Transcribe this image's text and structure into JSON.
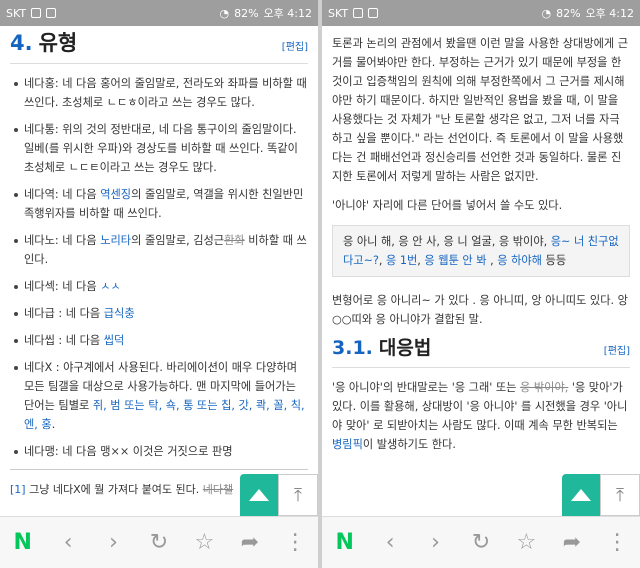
{
  "status": {
    "carrier": "SKT",
    "battery": "82%",
    "time": "오후 4:12"
  },
  "left": {
    "heading": {
      "number": "4.",
      "title": "유형",
      "edit": "[편집]"
    },
    "items": [
      {
        "text": "네다홍: 네 다음 홍어의 줄임말로, 전라도와 좌파를 비하할 때 쓰인다. 초성체로 ㄴㄷㅎ이라고 쓰는 경우도 많다."
      },
      {
        "text": "네다통: 위의 것의 정반대로, 네 다음 통구이의 줄임말이다. 일베(를 위시한 우파)와 경상도를 비하할 때 쓰인다. 똑같이 초성체로 ㄴㄷㅌ이라고 쓰는 경우도 많다."
      },
      {
        "pre": "네다역: 네 다음 ",
        "link": "역센징",
        "post": "의 줄임말로, 역갤을 위시한 친일반민족행위자를 비하할 때 쓰인다."
      },
      {
        "pre": "네다노: 네 다음 ",
        "link": "노리타",
        "mid": "의 줄임말로, 김성근",
        "strike": "환화",
        "post": " 비하할 때 쓰인다."
      },
      {
        "pre": "네다섹: 네 다음 ",
        "link": "ㅅㅅ",
        "post": ""
      },
      {
        "pre": "네다급 : 네 다음 ",
        "link": "급식충",
        "post": ""
      },
      {
        "pre": "네다씹 : 네 다음 ",
        "link": "씹덕",
        "post": ""
      },
      {
        "pre": "네다X : 야구계에서 사용된다. 바리에이션이 매우 다양하며 모든 팀갤을 대상으로 사용가능하다. 맨 마지막에 들어가는 단어는 팀별로 ",
        "link": "쥐, 범 또는 탁, 쇽, 통 또는 칩, 갓, 콱, 꼴, 칙, 엔, 홍",
        "post": "."
      },
      {
        "text": "네다맹: 네 다음 맹×× 이것은 거짓으로 판명"
      }
    ],
    "footnote": {
      "ref": "[1]",
      "text": " 그냥 네다X에 뭘 가져다 붙여도 된다. ",
      "strike": "네다챌"
    }
  },
  "right": {
    "para1": "토론과 논리의 관점에서 봤을땐 이런 말을 사용한 상대방에게 근거를 물어봐야만 한다. 부정하는 근거가 있기 때문에 부정을 한것이고 입증책임의 원칙에 의해 부정한쪽에서 그 근거를 제시해야만 하기 때문이다. 하지만 일반적인 용법을 봤을 때, 이 말을 사용했다는 것 자체가 \"난 토론할 생각은 없고, 그저 너를 자극하고 싶을 뿐이다.\" 라는 선언이다. 즉 토론에서 이 말을 사용했다는 건 패배선언과 정신승리를 선언한 것과 동일하다. 물론 진지한 토론에서 저렇게 말하는 사람은 없지만.",
    "para2": "'아니야' 자리에 다른 단어를 넣어서 쓸 수도 있다.",
    "quote": {
      "plain": "응 아니 해, 응 안 사, 응 니 얼굴, 응 밖이야, ",
      "link1": "응~ 너 친구없다고~?",
      "sep1": ", ",
      "link2": "응 1번",
      "sep2": ", ",
      "link3": "응 웹툰 안 봐",
      "sep3": " , ",
      "link4": "응 하야해",
      "tail": " 등등"
    },
    "para3": "변형어로 응 아니리~ 가 있다 . 응 아니띠, 앙 아니띠도 있다. 앙○○띠와 응 아니야가 결합된 말.",
    "subheading": {
      "number": "3.1.",
      "title": "대응법",
      "edit": "[편집]"
    },
    "para4": {
      "pre": "'응 아니야'의 반대말로는 '응 그래' 또는 ",
      "strike": "응 밖이야,",
      "mid": " '응 맞아'가 있다. 이를 활용해, 상대방이 '응 아니야' 를 시전했을 경우 '아니야 맞아' 로 되받아치는 사람도 많다. 이때 계속 무한 반복되는 ",
      "link": "병림픽",
      "post": "이 발생하기도 한다."
    }
  },
  "nav": {
    "logo": "N",
    "back": "‹",
    "forward": "›",
    "reload": "↻",
    "bookmark": "☆",
    "share": "➦",
    "more": "⋮",
    "top": "⤒"
  }
}
